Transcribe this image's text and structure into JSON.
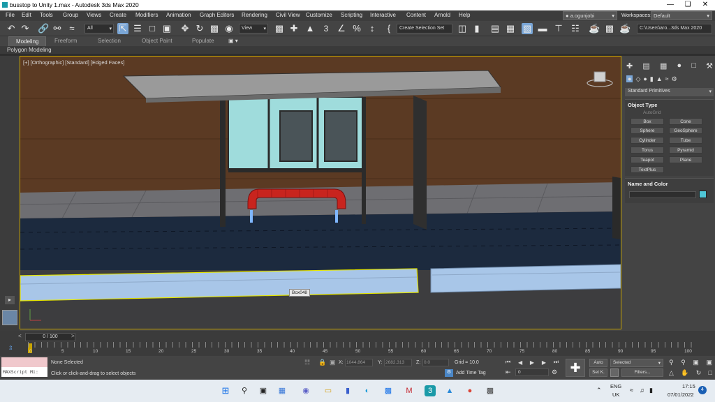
{
  "window": {
    "title": "busstop to Unity 1.max - Autodesk 3ds Max 2020"
  },
  "menu": {
    "items": [
      "File",
      "Edit",
      "Tools",
      "Group",
      "Views",
      "Create",
      "Modifiers",
      "Animation",
      "Graph Editors",
      "Rendering",
      "Civil View",
      "Customize",
      "Scripting",
      "Interactive",
      "Content",
      "Arnold",
      "Help"
    ],
    "user": "a.ogunjobi",
    "workspaces_label": "Workspaces:",
    "workspace": "Default"
  },
  "toolbar": {
    "filter": "All",
    "view": "View",
    "selection_set": "Create Selection Set",
    "path": "C:\\Users\\aro...3ds Max 2020"
  },
  "ribbon": {
    "tabs": [
      "Modeling",
      "Freeform",
      "Selection",
      "Object Paint",
      "Populate"
    ],
    "active": "Modeling",
    "sub": "Polygon Modeling"
  },
  "viewport": {
    "label": "[+] [Orthographic] [Standard] [Edged Faces]",
    "tooltip": "Box048"
  },
  "command_panel": {
    "category": "Standard Primitives",
    "object_type_title": "Object Type",
    "autogrid": "AutoGrid",
    "buttons": [
      "Box",
      "Cone",
      "Sphere",
      "GeoSphere",
      "Cylinder",
      "Tube",
      "Torus",
      "Pyramid",
      "Teapot",
      "Plane",
      "TextPlus"
    ],
    "name_color_title": "Name and Color",
    "swatch_color": "#4fc6d6"
  },
  "timeline": {
    "counter": "0 / 100",
    "ticks": [
      "0",
      "5",
      "10",
      "15",
      "20",
      "25",
      "30",
      "35",
      "40",
      "45",
      "50",
      "55",
      "60",
      "65",
      "70",
      "75",
      "80",
      "85",
      "90",
      "95",
      "100"
    ]
  },
  "status": {
    "maxscript": "MAXScript Mi:",
    "selection": "None Selected",
    "prompt": "Click or click-and-drag to select objects",
    "x_label": "X:",
    "x": "1044.864",
    "y_label": "Y:",
    "y": "2682.313",
    "z_label": "Z:",
    "z": "0.0",
    "grid": "Grid = 10.0",
    "add_time_tag": "Add Time Tag",
    "frame": "0",
    "auto": "Auto",
    "selected": "Selected",
    "setk": "Set K.",
    "filters": "Filters..."
  },
  "taskbar": {
    "lang1": "ENG",
    "lang2": "UK",
    "time": "17:15",
    "date": "07/01/2022",
    "notif": "4"
  }
}
